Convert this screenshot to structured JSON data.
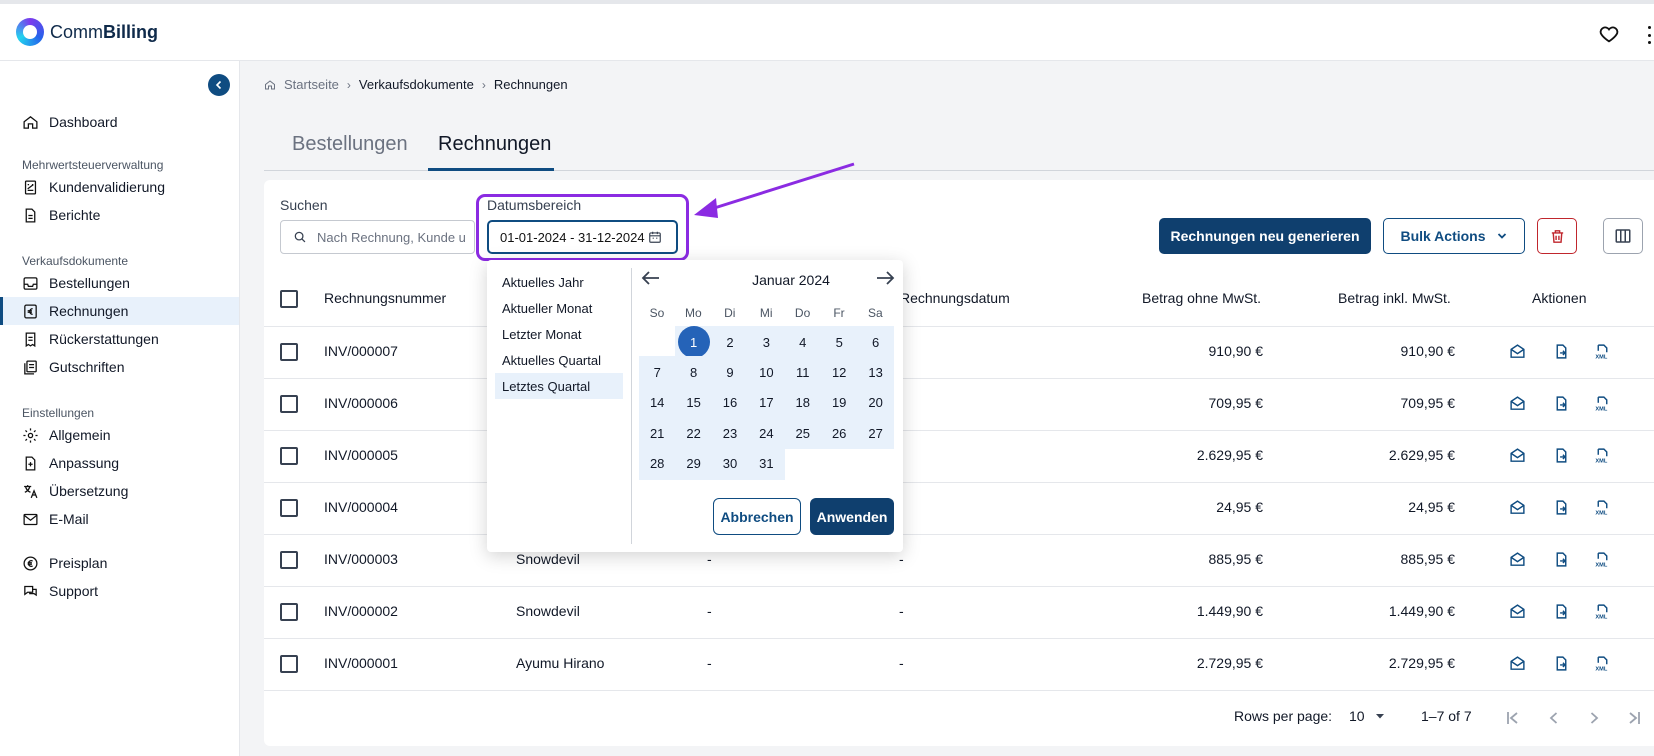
{
  "app": {
    "logo_light": "Comm",
    "logo_bold": "Billing"
  },
  "sidebar": {
    "items": [
      {
        "label": "Dashboard",
        "icon": "home-icon"
      },
      {
        "label": "Kundenvalidierung",
        "icon": "validation-icon"
      },
      {
        "label": "Berichte",
        "icon": "document-icon"
      },
      {
        "label": "Bestellungen",
        "icon": "inbox-icon"
      },
      {
        "label": "Rechnungen",
        "icon": "euro-document-icon"
      },
      {
        "label": "Rückerstattungen",
        "icon": "refund-icon"
      },
      {
        "label": "Gutschriften",
        "icon": "credit-note-icon"
      },
      {
        "label": "Allgemein",
        "icon": "gear-icon"
      },
      {
        "label": "Anpassung",
        "icon": "customize-icon"
      },
      {
        "label": "Übersetzung",
        "icon": "translate-icon"
      },
      {
        "label": "E-Mail",
        "icon": "mail-icon"
      },
      {
        "label": "Preisplan",
        "icon": "euro-circle-icon"
      },
      {
        "label": "Support",
        "icon": "chat-icon"
      }
    ],
    "sections": [
      "Mehrwertsteuerverwaltung",
      "Verkaufsdokumente",
      "Einstellungen"
    ]
  },
  "breadcrumb": [
    "Startseite",
    "Verkaufsdokumente",
    "Rechnungen"
  ],
  "tabs": [
    "Bestellungen",
    "Rechnungen"
  ],
  "filters": {
    "search_label": "Suchen",
    "search_placeholder": "Nach Rechnung, Kunde u",
    "date_label": "Datumsbereich",
    "date_value": "01-01-2024 - 31-12-2024"
  },
  "toolbar": {
    "regenerate_label": "Rechnungen neu generieren",
    "bulk_label": "Bulk Actions"
  },
  "table": {
    "headers": [
      "Rechnungsnummer",
      "Rechnungsdatum",
      "Betrag ohne MwSt.",
      "Betrag inkl. MwSt.",
      "Aktionen"
    ],
    "rows": [
      {
        "number": "INV/000007",
        "customer": "",
        "c3": "",
        "c4": "",
        "net": "910,90 €",
        "gross": "910,90 €"
      },
      {
        "number": "INV/000006",
        "customer": "",
        "c3": "",
        "c4": "",
        "net": "709,95 €",
        "gross": "709,95 €"
      },
      {
        "number": "INV/000005",
        "customer": "",
        "c3": "",
        "c4": "",
        "net": "2.629,95 €",
        "gross": "2.629,95 €"
      },
      {
        "number": "INV/000004",
        "customer": "",
        "c3": "",
        "c4": "",
        "net": "24,95 €",
        "gross": "24,95 €"
      },
      {
        "number": "INV/000003",
        "customer": "Snowdevil",
        "c3": "-",
        "c4": "-",
        "net": "885,95 €",
        "gross": "885,95 €"
      },
      {
        "number": "INV/000002",
        "customer": "Snowdevil",
        "c3": "-",
        "c4": "-",
        "net": "1.449,90 €",
        "gross": "1.449,90 €"
      },
      {
        "number": "INV/000001",
        "customer": "Ayumu Hirano",
        "c3": "-",
        "c4": "-",
        "net": "2.729,95 €",
        "gross": "2.729,95 €"
      }
    ]
  },
  "pagination": {
    "rows_label": "Rows per page:",
    "rows_value": "10",
    "range": "1–7 of 7"
  },
  "datepicker": {
    "presets": [
      "Aktuelles Jahr",
      "Aktueller Monat",
      "Letzter Monat",
      "Aktuelles Quartal",
      "Letztes Quartal"
    ],
    "month_title": "Januar 2024",
    "weekdays": [
      "So",
      "Mo",
      "Di",
      "Mi",
      "Do",
      "Fr",
      "Sa"
    ],
    "days": [
      "1",
      "2",
      "3",
      "4",
      "5",
      "6",
      "7",
      "8",
      "9",
      "10",
      "11",
      "12",
      "13",
      "14",
      "15",
      "16",
      "17",
      "18",
      "19",
      "20",
      "21",
      "22",
      "23",
      "24",
      "25",
      "26",
      "27",
      "28",
      "29",
      "30",
      "31"
    ],
    "cancel_label": "Abbrechen",
    "apply_label": "Anwenden"
  },
  "colors": {
    "primary": "#0f3f6e",
    "accent": "#2563b8",
    "highlight": "#8b2be2",
    "danger": "#c0262d"
  }
}
